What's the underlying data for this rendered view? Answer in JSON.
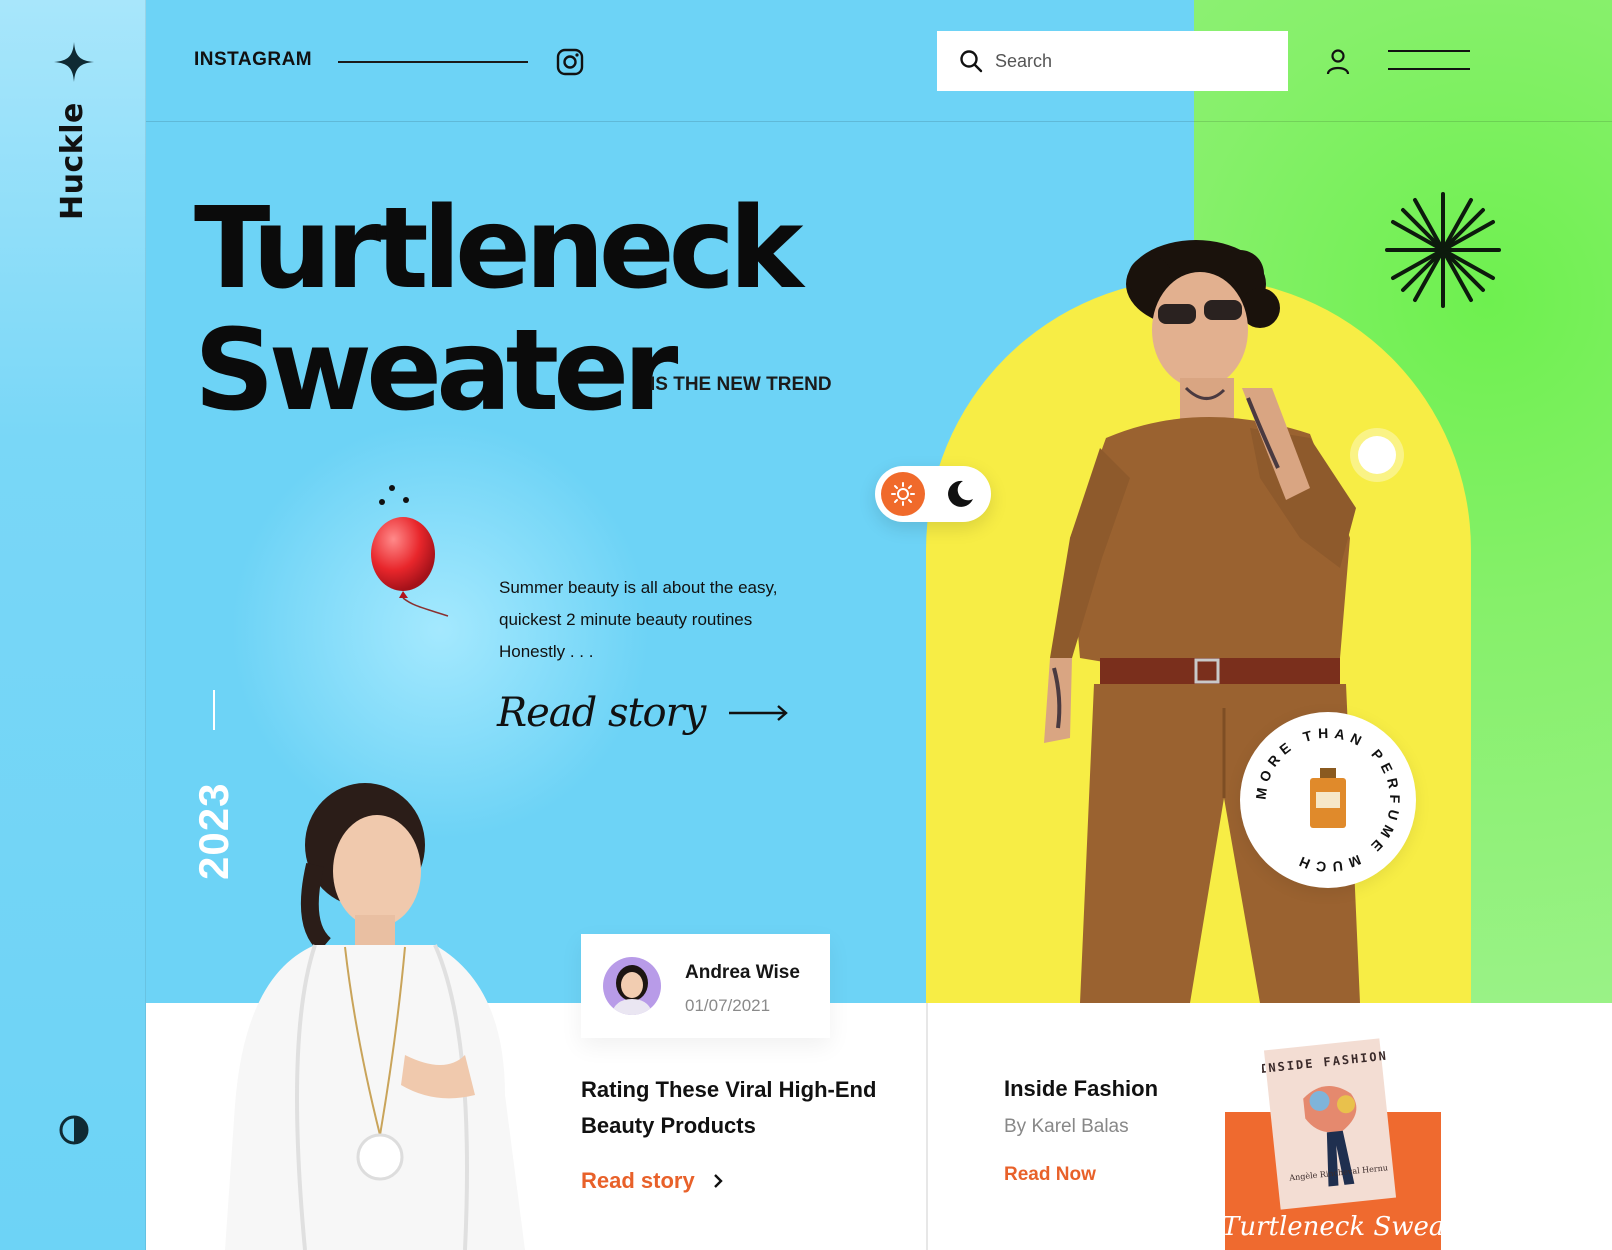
{
  "brand": {
    "name": "Huckle",
    "star_icon": "four-point-star-icon"
  },
  "header": {
    "social_label": "INSTAGRAM",
    "social_icon": "instagram-icon",
    "search": {
      "placeholder": "Search",
      "value": ""
    },
    "user_icon": "user-icon",
    "menu_icon": "hamburger-menu-icon"
  },
  "hero": {
    "title_line1": "Turtleneck",
    "title_line2": "Sweater",
    "subtitle": "IS THE NEW TREND",
    "year": "2023",
    "story_text": "Summer beauty is all about the easy, quickest 2 minute beauty routines Honestly . . .",
    "read_story_label": "Read story"
  },
  "theme_toggle": {
    "active": "light",
    "sun_icon": "sun-icon",
    "moon_icon": "moon-icon"
  },
  "perfume_badge": {
    "text": "MORE THAN PERFUME MUCH"
  },
  "article": {
    "author_name": "Andrea Wise",
    "author_date": "01/07/2021",
    "title": "Rating These Viral High-End Beauty Products",
    "link_label": "Read story"
  },
  "feature": {
    "title": "Inside Fashion",
    "author": "By Karel Balas",
    "link_label": "Read Now",
    "book_title": "INSIDE FASHION",
    "book_author": "Angèle Rincheval Hernu",
    "script_text": "Turtleneck Sweater"
  },
  "colors": {
    "sky_blue": "#6dd3f6",
    "lime_green": "#86f06a",
    "yellow": "#f7ed45",
    "accent_orange": "#e8612a",
    "brown": "#9a6230"
  }
}
